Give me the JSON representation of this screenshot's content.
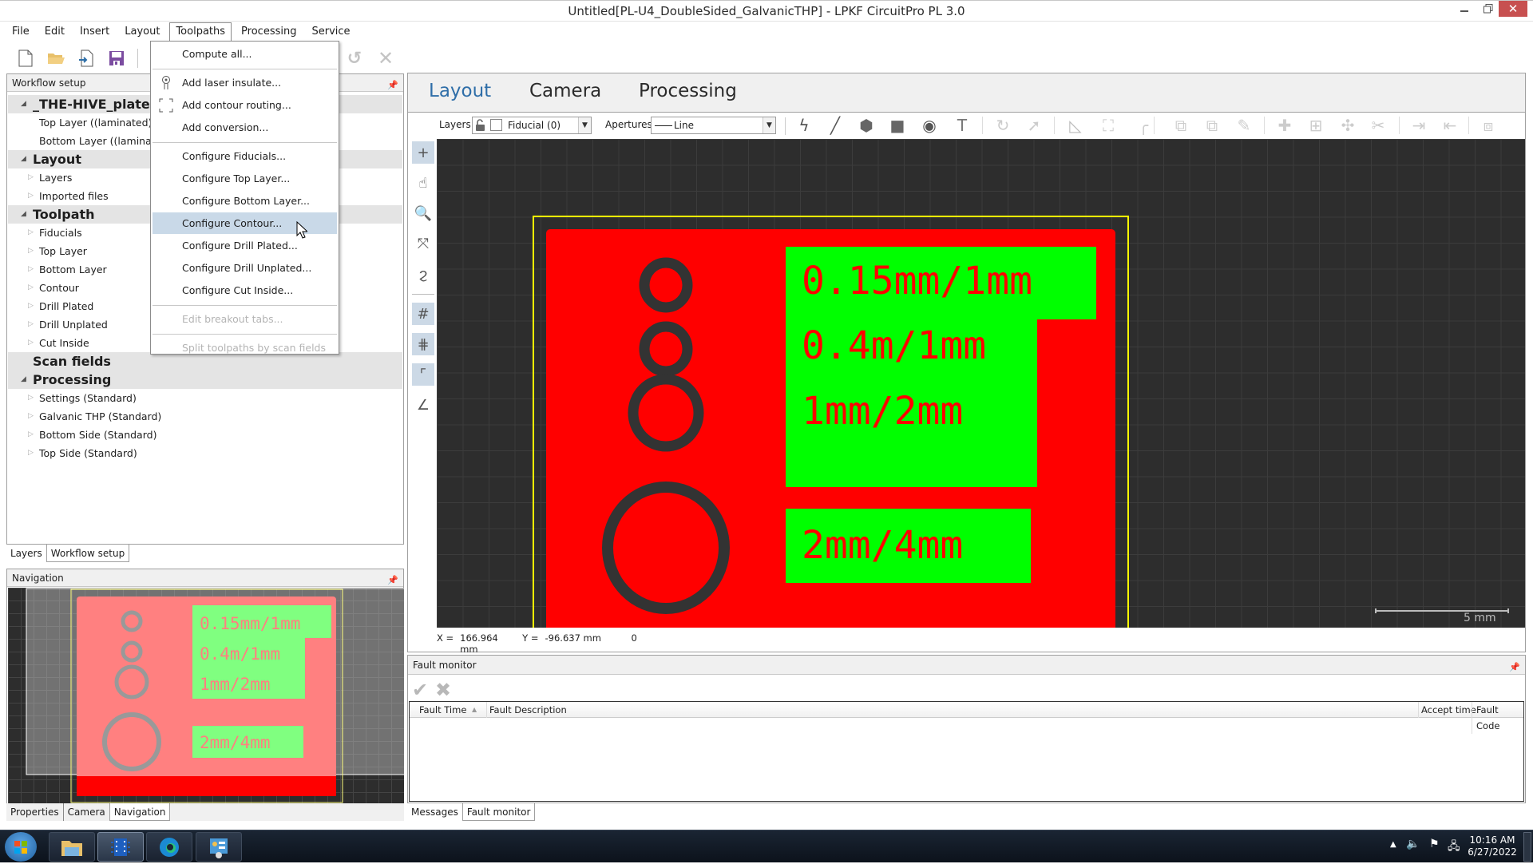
{
  "window": {
    "title": "Untitled[PL-U4_DoubleSided_GalvanicTHP] - LPKF CircuitPro PL 3.0",
    "minimize_icon": "minimize-icon",
    "restore_icon": "restore-icon",
    "close_icon": "close-icon"
  },
  "menubar": {
    "items": [
      "File",
      "Edit",
      "Insert",
      "Layout",
      "Toolpaths",
      "Processing",
      "Service"
    ],
    "open_menu": "Toolpaths"
  },
  "toolbar": {
    "icons": [
      "new-file-icon",
      "open-folder-icon",
      "import-icon",
      "save-icon",
      "refresh-icon",
      "cancel-icon"
    ]
  },
  "toolpaths_menu": {
    "items": [
      {
        "label": "Compute all...",
        "icon": null,
        "enabled": true
      },
      {
        "separator": true
      },
      {
        "label": "Add laser insulate...",
        "icon": "laser-icon",
        "enabled": true
      },
      {
        "label": "Add contour routing...",
        "icon": "contour-icon",
        "enabled": true
      },
      {
        "label": "Add conversion...",
        "icon": null,
        "enabled": true
      },
      {
        "separator": true
      },
      {
        "label": "Configure Fiducials...",
        "enabled": true
      },
      {
        "label": "Configure Top Layer...",
        "enabled": true
      },
      {
        "label": "Configure Bottom Layer...",
        "enabled": true
      },
      {
        "label": "Configure Contour...",
        "enabled": true,
        "highlighted": true
      },
      {
        "label": "Configure Drill Plated...",
        "enabled": true
      },
      {
        "label": "Configure Drill Unplated...",
        "enabled": true
      },
      {
        "label": "Configure Cut Inside...",
        "enabled": true
      },
      {
        "separator": true
      },
      {
        "label": "Edit breakout tabs...",
        "enabled": false
      },
      {
        "separator": true
      },
      {
        "label": "Split toolpaths by scan fields",
        "enabled": false
      }
    ]
  },
  "workflow_panel": {
    "title": "Workflow setup",
    "tree": [
      {
        "label": "_THE-HIVE_plated_F",
        "type": "category",
        "expanded": true
      },
      {
        "label": "Top Layer ((laminated))",
        "type": "leaf"
      },
      {
        "label": "Bottom Layer ((laminated))",
        "type": "leaf"
      },
      {
        "label": "Layout",
        "type": "category",
        "expanded": true
      },
      {
        "label": "Layers",
        "type": "node"
      },
      {
        "label": "Imported files",
        "type": "node"
      },
      {
        "label": "Toolpath",
        "type": "category",
        "expanded": true
      },
      {
        "label": "Fiducials",
        "type": "node"
      },
      {
        "label": "Top Layer",
        "type": "node"
      },
      {
        "label": "Bottom Layer",
        "type": "node"
      },
      {
        "label": "Contour",
        "type": "node"
      },
      {
        "label": "Drill Plated",
        "type": "node"
      },
      {
        "label": "Drill Unplated",
        "type": "node"
      },
      {
        "label": "Cut Inside",
        "type": "node"
      },
      {
        "label": "Scan fields",
        "type": "category",
        "expanded": false
      },
      {
        "label": "Processing",
        "type": "category",
        "expanded": true
      },
      {
        "label": "Settings (Standard)",
        "type": "node"
      },
      {
        "label": "Galvanic THP (Standard)",
        "type": "node"
      },
      {
        "label": "Bottom Side (Standard)",
        "type": "node"
      },
      {
        "label": "Top Side (Standard)",
        "type": "node"
      }
    ],
    "tabs": [
      "Layers",
      "Workflow setup"
    ],
    "active_tab": "Workflow setup"
  },
  "navigation_panel": {
    "title": "Navigation",
    "tabs": [
      "Properties",
      "Camera",
      "Navigation"
    ],
    "active_tab": "Navigation"
  },
  "main_view": {
    "tabs": [
      "Layout",
      "Camera",
      "Processing"
    ],
    "active_tab": "Layout",
    "layers_label": "Layers",
    "layer_value": "Fiducial (0)",
    "apertures_label": "Apertures",
    "aperture_value": "Line",
    "draw_tools": [
      "flash-icon",
      "line-icon",
      "polygon-icon",
      "rectangle-icon",
      "circle-icon",
      "text-icon",
      "rotate-icon",
      "move-icon",
      "mirror-icon",
      "scale-icon",
      "arc-icon",
      "copy-icon",
      "paste-icon",
      "edit-icon",
      "add-node-icon",
      "align-icon",
      "move-node-icon",
      "cut-icon",
      "export-icon",
      "import-icon",
      "group-icon"
    ],
    "side_tools": [
      "crosshair-icon",
      "hand-pan-icon",
      "zoom-icon",
      "fit-view-icon",
      "lasso-icon",
      "grid-icon",
      "snap-grid-icon",
      "origin-icon",
      "angle-icon"
    ],
    "board": {
      "labels": [
        "0.15mm/1mm",
        "0.4m/1mm",
        "1mm/2mm",
        "2mm/4mm"
      ],
      "colors": {
        "copper": "#ff0000",
        "silk": "#00ff00",
        "background": "#2d2d2d",
        "outline": "#ffff00"
      }
    },
    "scale_label": "5 mm",
    "status": {
      "x_label": "X =",
      "x_value": "166.964 mm",
      "y_label": "Y =",
      "y_value": "-96.637 mm",
      "extra": "0"
    }
  },
  "fault_monitor": {
    "title": "Fault monitor",
    "columns": [
      "Fault Time",
      "Fault Description",
      "Accept time",
      "Fault Code"
    ],
    "rows": [],
    "tabs": [
      "Messages",
      "Fault monitor"
    ],
    "active_tab": "Fault monitor"
  },
  "taskbar": {
    "apps": [
      "start-button",
      "file-explorer",
      "circuitpro",
      "edge-browser",
      "control-panel"
    ],
    "time": "10:16 AM",
    "date": "6/27/2022"
  }
}
